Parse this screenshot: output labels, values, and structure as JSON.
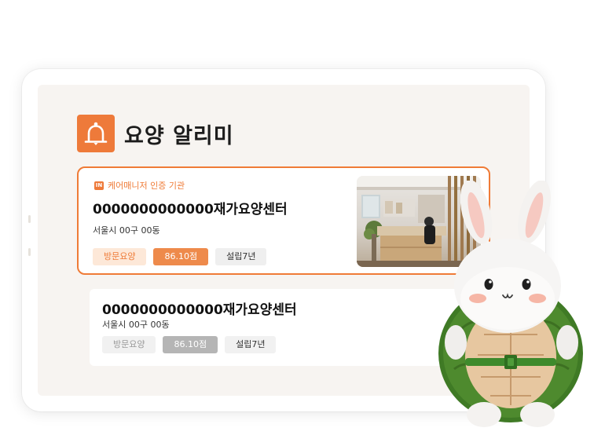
{
  "brand": {
    "title": "요양 알리미",
    "logo_icon": "bell-icon"
  },
  "card_featured": {
    "certification": "케어매니저 인증 기관",
    "name": "0000000000000재가요양센터",
    "address": "서울시 00구 00동",
    "tags": [
      "방문요양",
      "86.10점",
      "설립7년"
    ]
  },
  "card_secondary": {
    "name": "0000000000000재가요양센터",
    "address": "서울시 00구 00동",
    "tags": [
      "방문요양",
      "86.10점",
      "설립7년"
    ]
  },
  "colors": {
    "accent": "#ef7b37",
    "screen_bg": "#f7f4f1",
    "turtle_shell": "#4e8a2e"
  }
}
